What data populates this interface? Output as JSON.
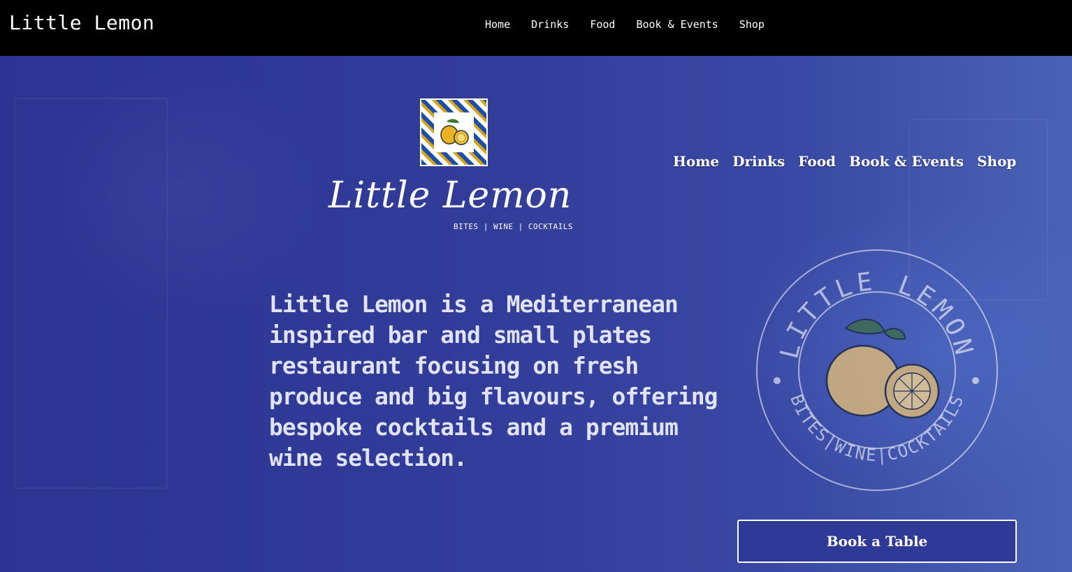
{
  "header": {
    "brand": "Little Lemon",
    "nav": [
      "Home",
      "Drinks",
      "Food",
      "Book & Events",
      "Shop"
    ]
  },
  "hero": {
    "logo_script": "Little Lemon",
    "tagline": "BITES | WINE | COCKTAILS",
    "nav": [
      "Home",
      "Drinks",
      "Food",
      "Book & Events",
      "Shop"
    ],
    "description": "Little Lemon is a Mediterranean inspired bar and small plates restaurant focusing on fresh produce and big flavours, offering bespoke cocktails and a premium wine selection.",
    "badge_top_text": "LITTLE LEMON",
    "badge_bottom_text": "BITES|WINE|COCKTAILS",
    "cta_label": "Book a Table"
  },
  "colors": {
    "topbar": "#000000",
    "hero_blue": "#2f3a96",
    "text_white": "#ffffff"
  },
  "icons": {
    "tile_logo": "lemon-tile-icon",
    "badge_logo": "lemon-icon"
  }
}
